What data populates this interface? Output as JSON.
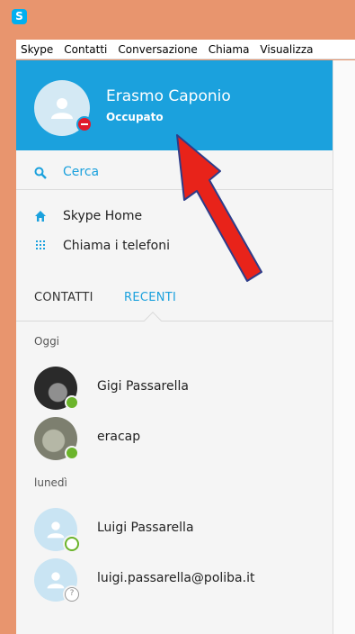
{
  "menu": [
    "Skype",
    "Contatti",
    "Conversazione",
    "Chiama",
    "Visualizza"
  ],
  "profile": {
    "name": "Erasmo Caponio",
    "status": "Occupato",
    "status_color": "#e0192c"
  },
  "search": {
    "label": "Cerca"
  },
  "nav": [
    {
      "label": "Skype Home",
      "icon": "home-icon"
    },
    {
      "label": "Chiama i telefoni",
      "icon": "dialpad-icon"
    }
  ],
  "tabs": {
    "contacts": "CONTATTI",
    "recent": "RECENTI",
    "active": "RECENTI"
  },
  "sections": [
    {
      "label": "Oggi",
      "contacts": [
        {
          "name": "Gigi Passarella",
          "presence": "online"
        },
        {
          "name": "eracap",
          "presence": "online"
        }
      ]
    },
    {
      "label": "lunedì",
      "contacts": [
        {
          "name": "Luigi Passarella",
          "presence": "offline"
        },
        {
          "name": "luigi.passarella@poliba.it",
          "presence": "unknown"
        }
      ]
    }
  ],
  "colors": {
    "accent": "#1ba1dd",
    "online": "#6bb42b",
    "busy": "#e0192c",
    "annotation_arrow": "#e8231a"
  }
}
